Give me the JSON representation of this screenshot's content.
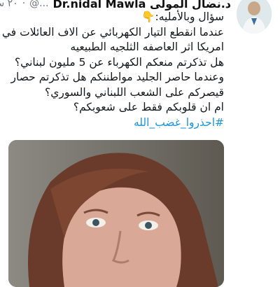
{
  "tweet": {
    "author_name": "د.نضال المولى Dr.nidal Mawla",
    "author_handle": "@...",
    "dot": "·",
    "time": "٢٠ س",
    "emoji_hint": "👇",
    "lines": [
      "سؤال وبالأمليه:",
      "عندما انقطع التيار الكهربائي عن الاف العائلات في",
      "امريكا اثر العاصفه الثلجيه الطبيعيه",
      "هل تذكرتم منعكم الكهرباء عن 5 مليون لبناني؟",
      "وعندما حاصر الجليد مواطننكم هل تذكرتم حصار",
      "قيصركم على الشعب اللبناني والسوري؟",
      "ام ان قلوبكم فقط على شعوبكم؟"
    ],
    "hashtag": "#احذروا_غضب_الله"
  },
  "colors": {
    "link": "#1b95e0",
    "text": "#14171a",
    "muted": "#6b7680"
  }
}
